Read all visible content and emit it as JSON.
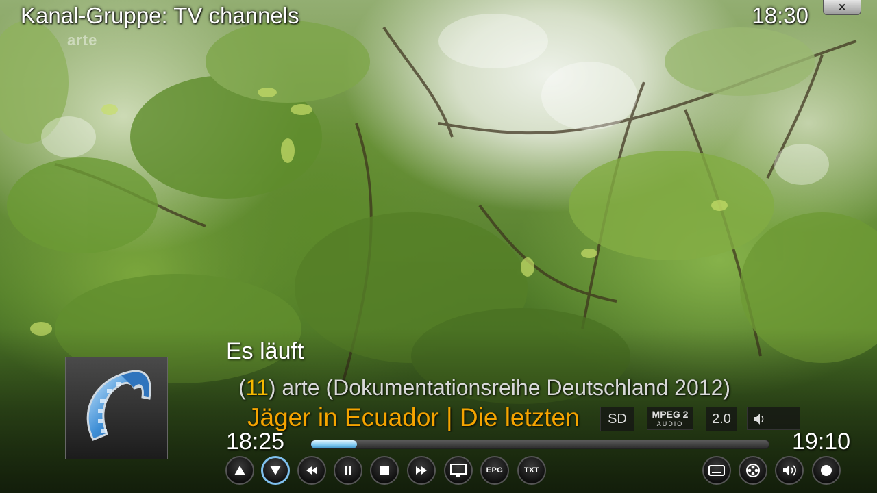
{
  "header": {
    "title": "Kanal-Gruppe: TV channels",
    "clock": "18:30",
    "close_label": "×"
  },
  "video": {
    "watermark": "arte"
  },
  "info": {
    "now_label": "Es läuft",
    "channel_number": "11",
    "channel_text": "arte (Dokumentationsreihe Deutschland 2012)",
    "programme_title": "Jäger in Ecuador | Die letzten",
    "start_time": "18:25",
    "end_time": "19:10",
    "progress_percent": 10
  },
  "badges": {
    "resolution": "SD",
    "audio_codec": "MPEG 2",
    "audio_codec_sub": "AUDIO",
    "channels": "2.0"
  },
  "controls": {
    "left": [
      {
        "name": "channel-up-button",
        "icon": "triangle-up-icon"
      },
      {
        "name": "channel-down-button",
        "icon": "triangle-down-icon",
        "active": true
      },
      {
        "name": "rewind-button",
        "icon": "rewind-icon"
      },
      {
        "name": "pause-button",
        "icon": "pause-icon"
      },
      {
        "name": "stop-button",
        "icon": "stop-icon"
      },
      {
        "name": "fast-forward-button",
        "icon": "fast-forward-icon"
      },
      {
        "name": "tv-button",
        "icon": "tv-icon"
      },
      {
        "name": "epg-button",
        "icon": "epg-text",
        "label": "EPG"
      },
      {
        "name": "teletext-button",
        "icon": "txt-text",
        "label": "TXT"
      }
    ],
    "right": [
      {
        "name": "subtitles-button",
        "icon": "subtitles-icon"
      },
      {
        "name": "video-settings-button",
        "icon": "film-reel-icon"
      },
      {
        "name": "audio-settings-button",
        "icon": "speaker-icon"
      },
      {
        "name": "record-button",
        "icon": "record-icon"
      }
    ]
  },
  "colors": {
    "accent_orange": "#f5a400",
    "channel_number_yellow": "#f5b800",
    "focus_blue": "#7fc0ee"
  }
}
